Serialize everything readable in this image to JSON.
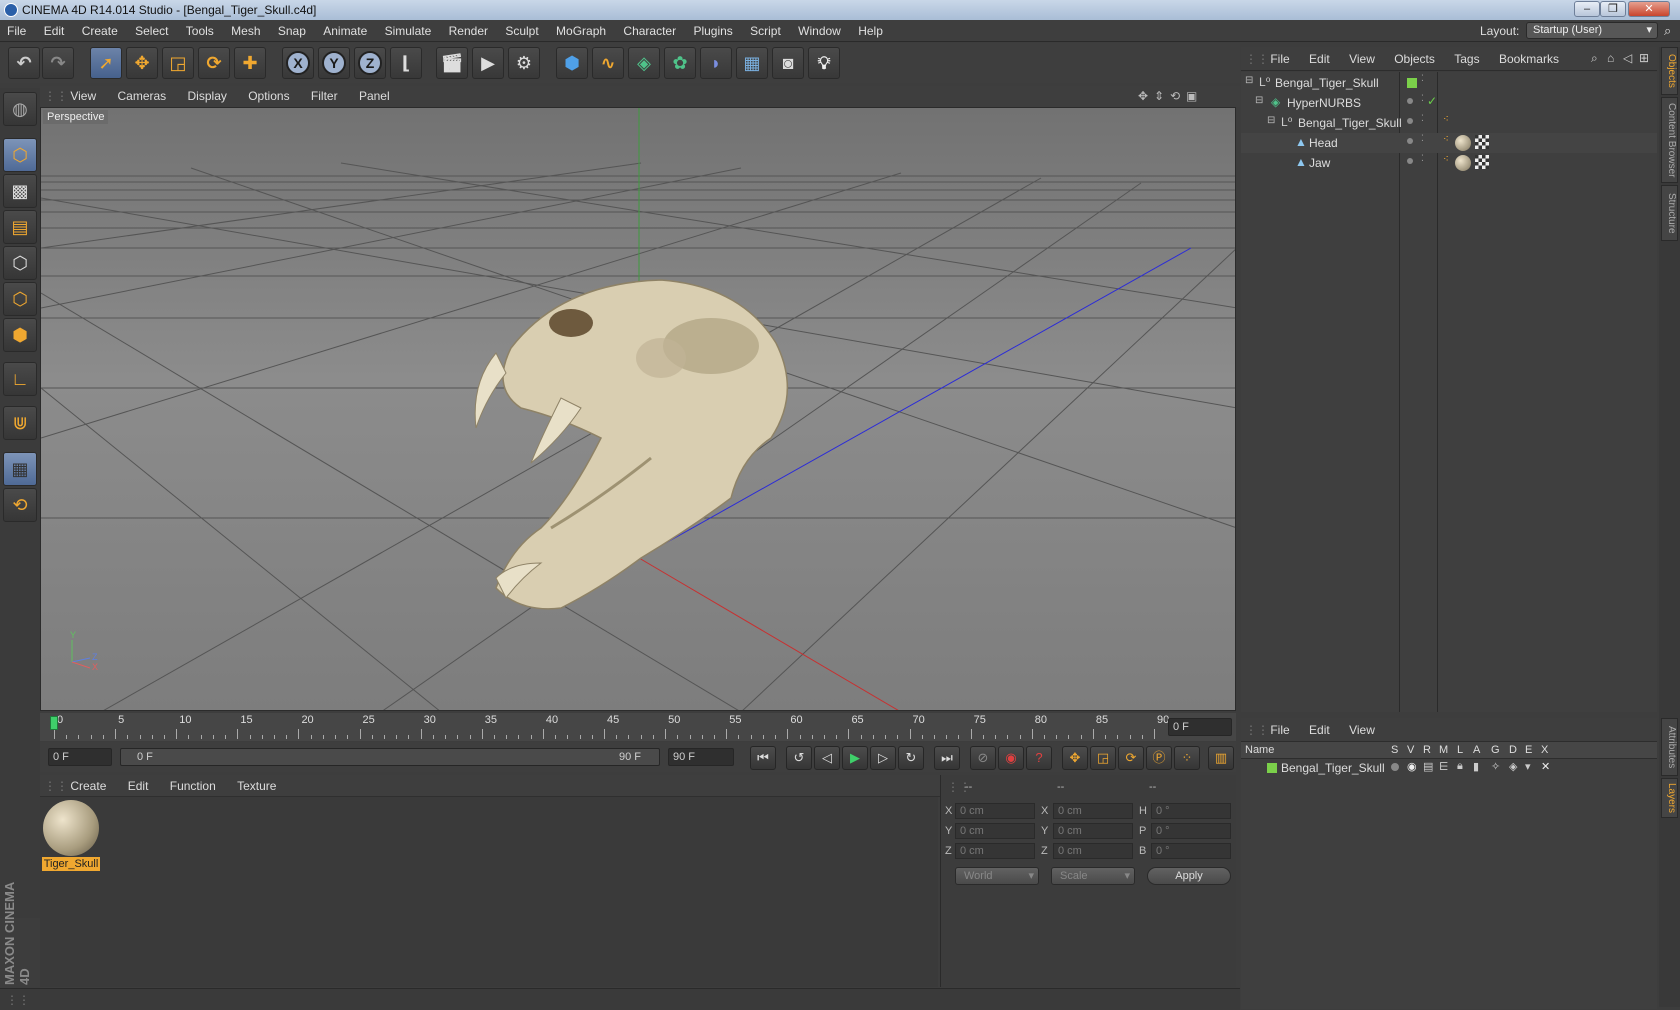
{
  "window": {
    "title": "CINEMA 4D R14.014 Studio - [Bengal_Tiger_Skull.c4d]"
  },
  "menubar": {
    "items": [
      "File",
      "Edit",
      "Create",
      "Select",
      "Tools",
      "Mesh",
      "Snap",
      "Animate",
      "Simulate",
      "Render",
      "Sculpt",
      "MoGraph",
      "Character",
      "Plugins",
      "Script",
      "Window",
      "Help"
    ],
    "layout_label": "Layout:",
    "layout_value": "Startup (User)"
  },
  "viewport": {
    "menu": [
      "View",
      "Cameras",
      "Display",
      "Options",
      "Filter",
      "Panel"
    ],
    "label": "Perspective",
    "axis_labels": {
      "y": "Y",
      "z": "Z",
      "x": "X"
    }
  },
  "timeline": {
    "ticks": [
      "0",
      "5",
      "10",
      "15",
      "20",
      "25",
      "30",
      "35",
      "40",
      "45",
      "50",
      "55",
      "60",
      "65",
      "70",
      "75",
      "80",
      "85",
      "90"
    ],
    "current_frame_field": "0 F",
    "start_field": "0 F",
    "range_start": "0 F",
    "range_end": "90 F",
    "end_field": "90 F"
  },
  "material_panel": {
    "menu": [
      "Create",
      "Edit",
      "Function",
      "Texture"
    ],
    "materials": [
      {
        "name": "Tiger_Skull"
      }
    ]
  },
  "coordinates": {
    "headers": [
      "--",
      "--",
      "--"
    ],
    "rows": [
      {
        "axis": "X",
        "pos": "0 cm",
        "axis2": "X",
        "size": "0 cm",
        "rot_label": "H",
        "rot": "0 °"
      },
      {
        "axis": "Y",
        "pos": "0 cm",
        "axis2": "Y",
        "size": "0 cm",
        "rot_label": "P",
        "rot": "0 °"
      },
      {
        "axis": "Z",
        "pos": "0 cm",
        "axis2": "Z",
        "size": "0 cm",
        "rot_label": "B",
        "rot": "0 °"
      }
    ],
    "space_select": "World",
    "mode_select": "Scale",
    "apply_label": "Apply"
  },
  "objects_panel": {
    "menu": [
      "File",
      "Edit",
      "View",
      "Objects",
      "Tags",
      "Bookmarks"
    ],
    "tree": [
      {
        "name": "Bengal_Tiger_Skull",
        "indent": 0
      },
      {
        "name": "HyperNURBS",
        "indent": 1
      },
      {
        "name": "Bengal_Tiger_Skull",
        "indent": 2
      },
      {
        "name": "Head",
        "indent": 3
      },
      {
        "name": "Jaw",
        "indent": 3
      }
    ]
  },
  "layers_panel": {
    "menu": [
      "File",
      "Edit",
      "View"
    ],
    "columns": [
      "Name",
      "S",
      "V",
      "R",
      "M",
      "L",
      "A",
      "G",
      "D",
      "E",
      "X"
    ],
    "rows": [
      {
        "name": "Bengal_Tiger_Skull",
        "color": "#7bd04a"
      }
    ]
  },
  "right_tabs": [
    "Objects",
    "Content Browser",
    "Structure",
    "Attributes",
    "Layers"
  ],
  "maxon_logo": "MAXON CINEMA 4D",
  "colors": {
    "accent": "#f0a830",
    "selected_tool": "#5a76a3",
    "layer_green": "#7bd04a"
  }
}
